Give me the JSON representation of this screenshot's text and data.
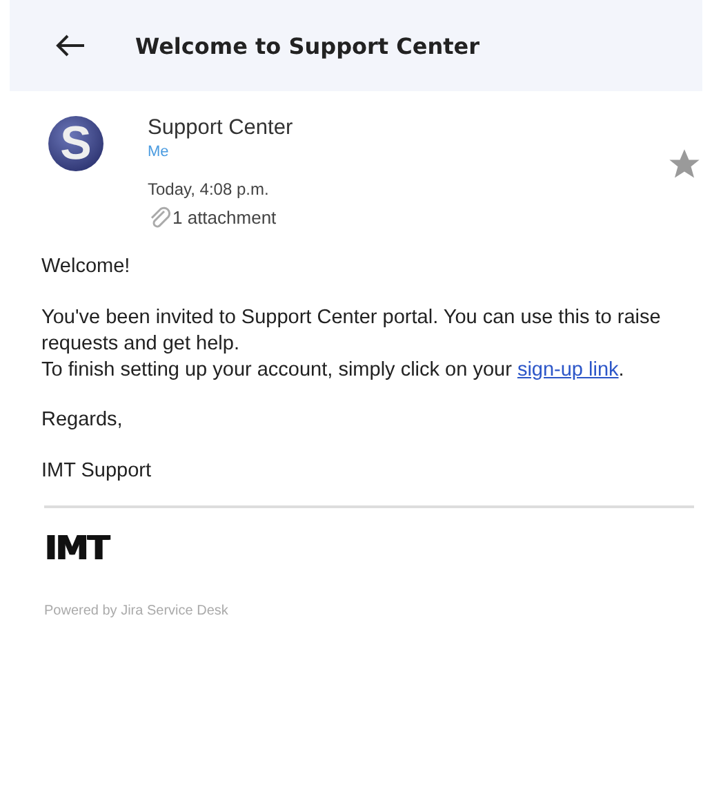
{
  "header": {
    "title": "Welcome to Support Center"
  },
  "message": {
    "sender": "Support Center",
    "recipient": "Me",
    "date": "Today, 4:08 p.m.",
    "attachments": "1 attachment",
    "starred": false,
    "avatar_letter": "S"
  },
  "body": {
    "greeting": "Welcome!",
    "paragraph": {
      "first": "You've been invited to Support Center portal. You can use this to raise requests and get help.",
      "second": "To finish setting up your account, simply click on your ",
      "link": "sign-up link",
      "end": "."
    },
    "closing": "Regards,",
    "signature": "IMT Support"
  },
  "footer": {
    "logo": "IMT",
    "powered": "Powered by Jira Service Desk"
  }
}
